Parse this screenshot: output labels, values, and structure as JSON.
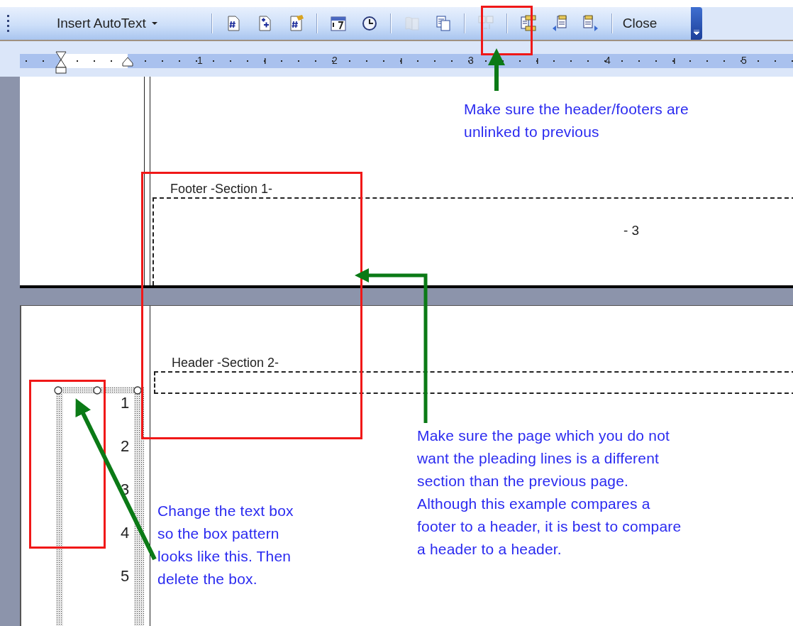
{
  "toolbar": {
    "groups": [
      [
        {
          "kind": "menu",
          "label": "Insert AutoText",
          "disabled": false
        }
      ],
      [
        {
          "kind": "icon",
          "disabled": false
        },
        {
          "kind": "icon",
          "disabled": false
        },
        {
          "kind": "icon",
          "disabled": false
        }
      ],
      [
        {
          "kind": "icon",
          "disabled": false
        },
        {
          "kind": "icon",
          "disabled": false
        }
      ],
      [
        {
          "kind": "icon",
          "disabled": true
        },
        {
          "kind": "icon",
          "disabled": false
        }
      ],
      [
        {
          "kind": "icon",
          "disabled": true
        }
      ],
      [
        {
          "kind": "icon",
          "disabled": false
        },
        {
          "kind": "icon",
          "disabled": false
        },
        {
          "kind": "icon",
          "disabled": false
        }
      ],
      [
        {
          "kind": "text",
          "label": "Close",
          "disabled": false
        }
      ]
    ]
  },
  "ruler": {
    "labels": [
      "1",
      "2",
      "3",
      "4",
      "5"
    ]
  },
  "page_1": {
    "footer_label": "Footer -Section 1-",
    "footer_text": "- 3"
  },
  "page_2": {
    "header_label": "Header -Section 2-",
    "line_numbers": [
      "1",
      "2",
      "3",
      "4",
      "5"
    ]
  },
  "callouts": [
    {
      "lines": [
        "Make sure the header/footers are",
        "unlinked to previous"
      ]
    },
    {
      "lines": [
        "Make sure the page which you do not",
        "want the pleading lines is a different",
        "section than the previous page.",
        "Although this example compares a",
        "footer to a header, it is best to compare",
        "a header to a header."
      ]
    },
    {
      "lines": [
        "Change the text box",
        "so the box pattern",
        "looks like this.  Then",
        "delete the box."
      ]
    }
  ]
}
